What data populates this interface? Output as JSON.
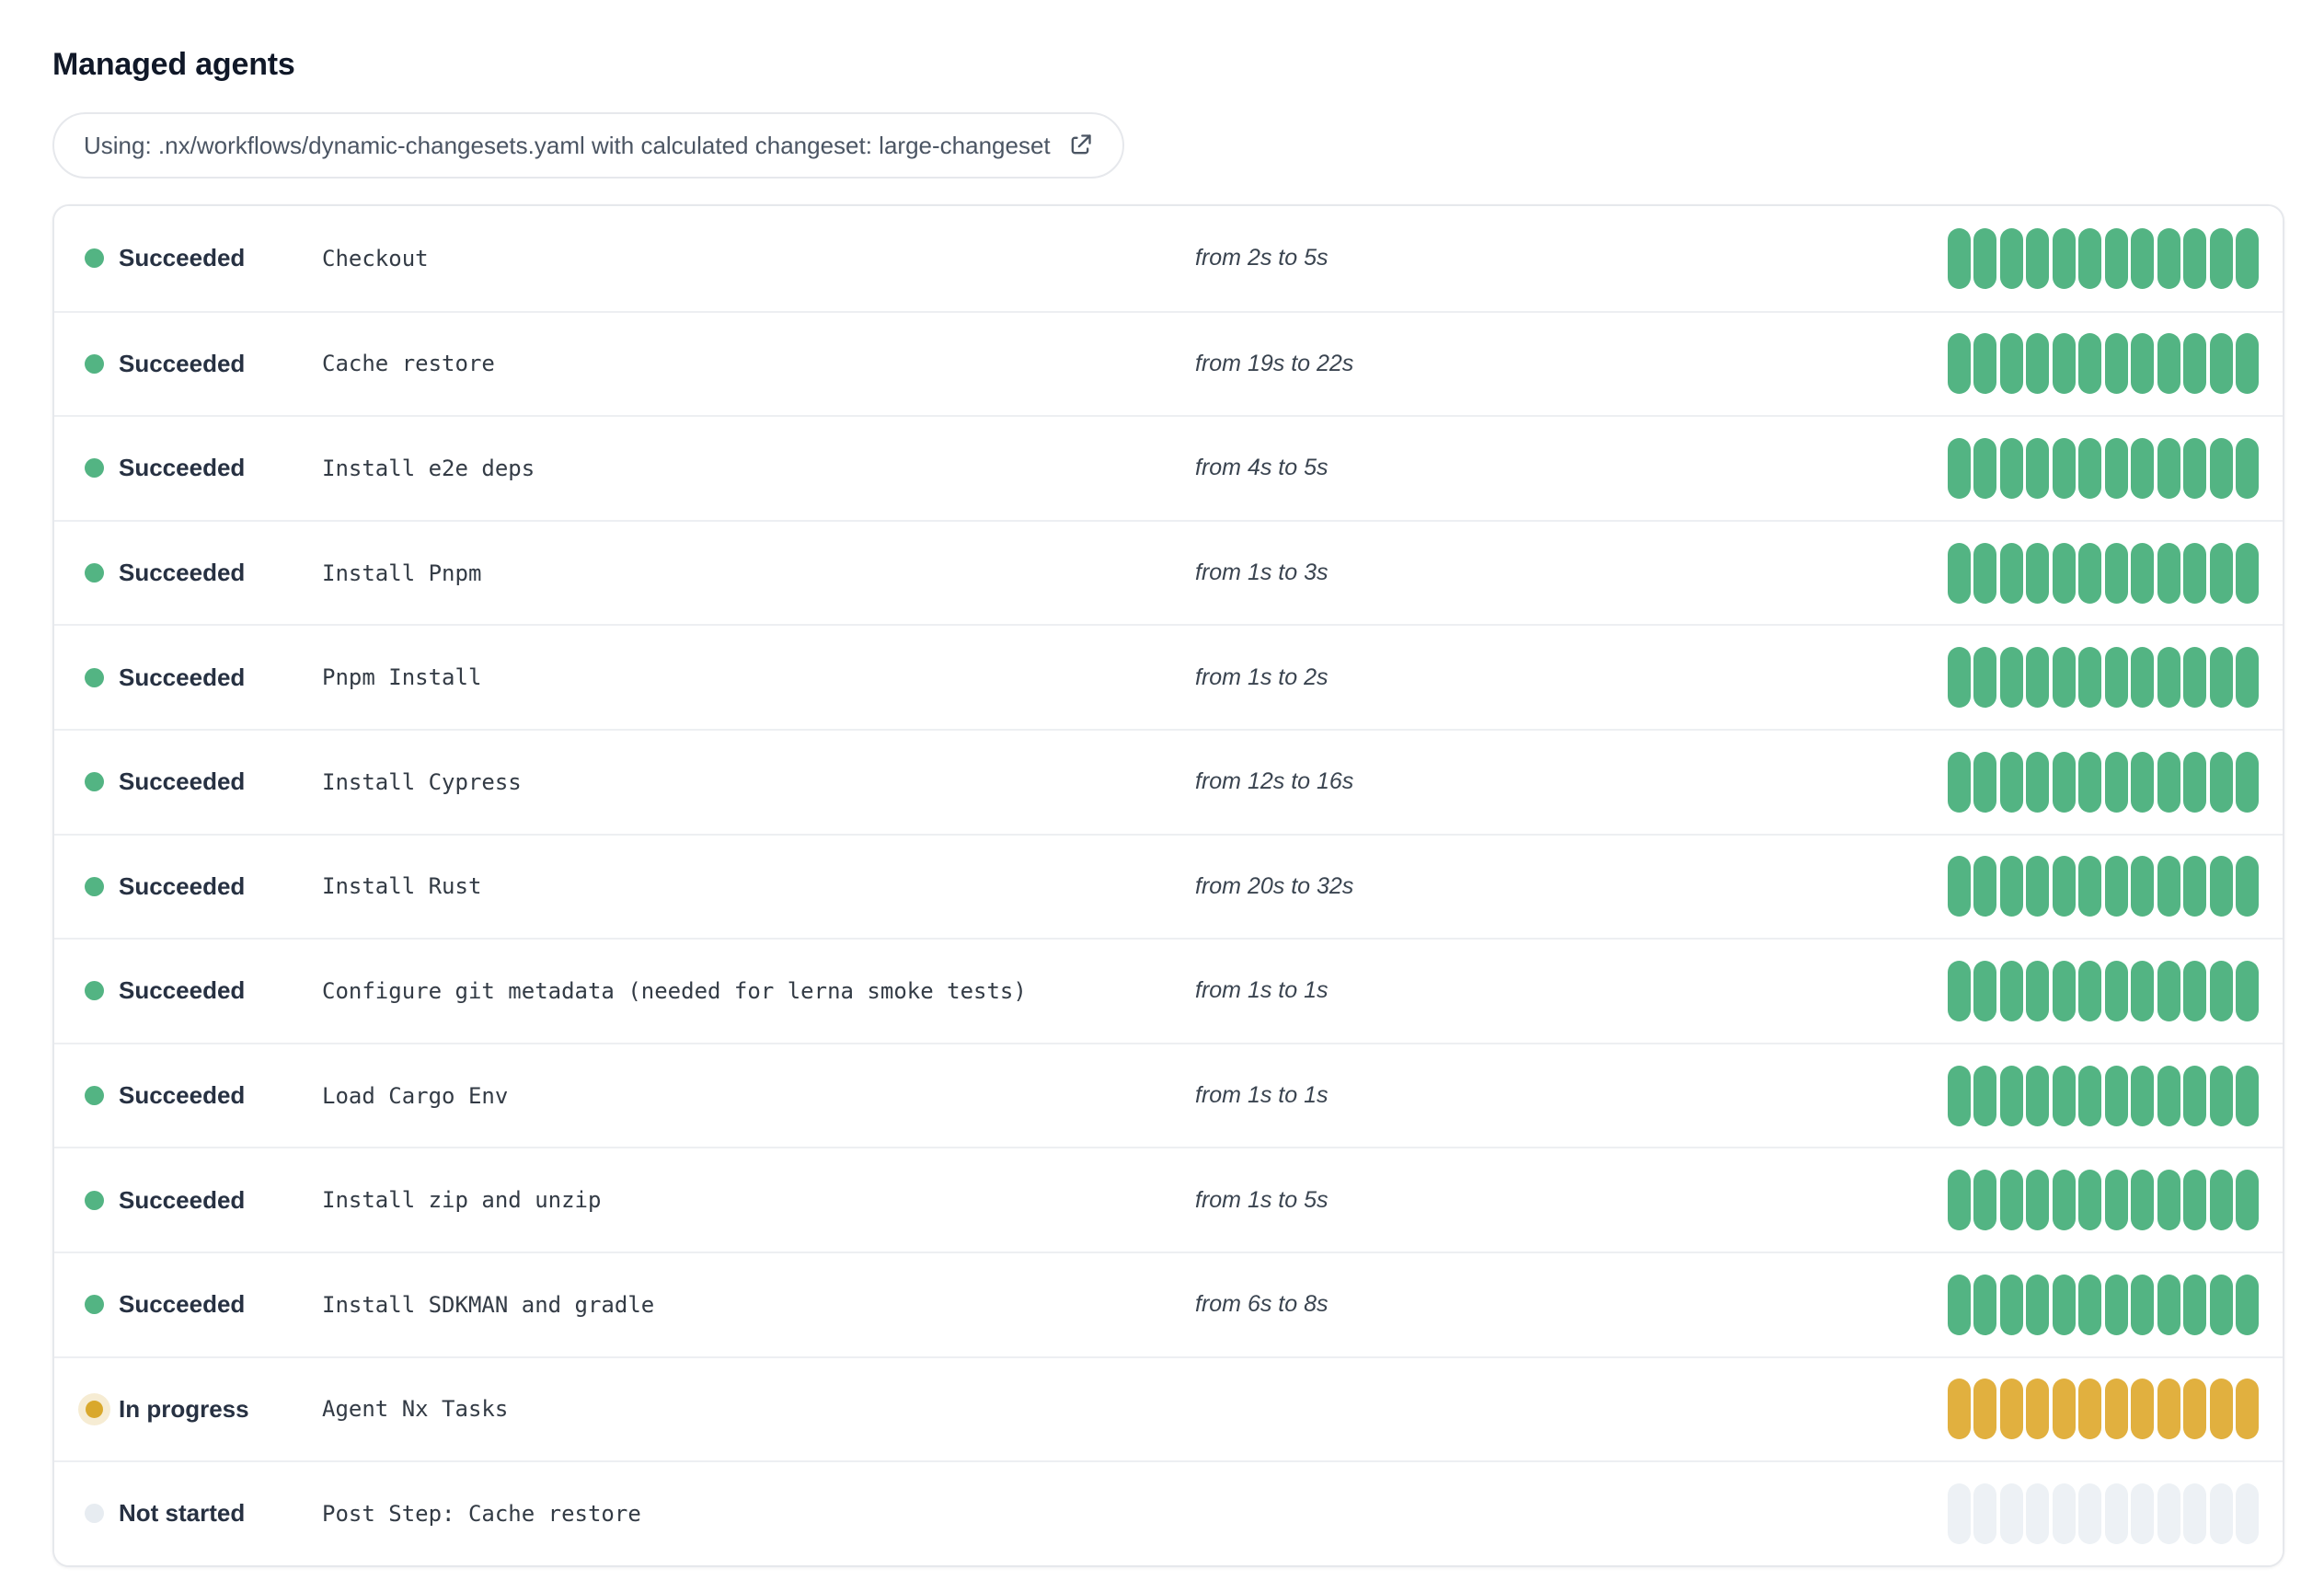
{
  "page": {
    "title": "Managed agents"
  },
  "banner": {
    "text": "Using: .nx/workflows/dynamic-changesets.yaml with calculated changeset: large-changeset",
    "icon": "external-link-icon"
  },
  "colors": {
    "succeeded": "#53b483",
    "in_progress": "#e1b03f",
    "in_progress_dot": "#d9a82c",
    "in_progress_halo": "#f6ecd3",
    "not_started": "#edf1f5",
    "not_started_dot": "#e7ecf1"
  },
  "agents": {
    "pill_count": 12,
    "rows": [
      {
        "status": "Succeeded",
        "status_key": "succeeded",
        "name": "Checkout",
        "duration": "from 2s to 5s"
      },
      {
        "status": "Succeeded",
        "status_key": "succeeded",
        "name": "Cache restore",
        "duration": "from 19s to 22s"
      },
      {
        "status": "Succeeded",
        "status_key": "succeeded",
        "name": "Install e2e deps",
        "duration": "from 4s to 5s"
      },
      {
        "status": "Succeeded",
        "status_key": "succeeded",
        "name": "Install Pnpm",
        "duration": "from 1s to 3s"
      },
      {
        "status": "Succeeded",
        "status_key": "succeeded",
        "name": "Pnpm Install",
        "duration": "from 1s to 2s"
      },
      {
        "status": "Succeeded",
        "status_key": "succeeded",
        "name": "Install Cypress",
        "duration": "from 12s to 16s"
      },
      {
        "status": "Succeeded",
        "status_key": "succeeded",
        "name": "Install Rust",
        "duration": "from 20s to 32s"
      },
      {
        "status": "Succeeded",
        "status_key": "succeeded",
        "name": "Configure git metadata (needed for lerna smoke tests)",
        "duration": "from 1s to 1s"
      },
      {
        "status": "Succeeded",
        "status_key": "succeeded",
        "name": "Load Cargo Env",
        "duration": "from 1s to 1s"
      },
      {
        "status": "Succeeded",
        "status_key": "succeeded",
        "name": "Install zip and unzip",
        "duration": "from 1s to 5s"
      },
      {
        "status": "Succeeded",
        "status_key": "succeeded",
        "name": "Install SDKMAN and gradle",
        "duration": "from 6s to 8s"
      },
      {
        "status": "In progress",
        "status_key": "in-progress",
        "name": "Agent Nx Tasks",
        "duration": ""
      },
      {
        "status": "Not started",
        "status_key": "not-started",
        "name": "Post Step: Cache restore",
        "duration": ""
      }
    ]
  }
}
